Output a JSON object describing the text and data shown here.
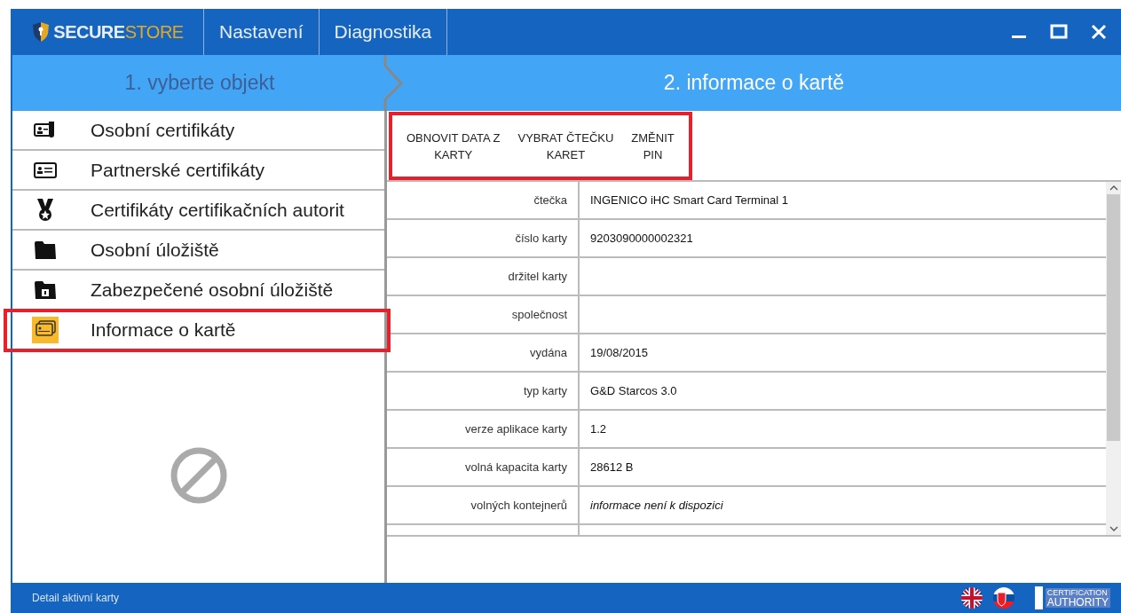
{
  "logo": {
    "primary": "SECURE",
    "secondary": "STORE"
  },
  "menu": [
    {
      "label": "Nastavení"
    },
    {
      "label": "Diagnostika"
    }
  ],
  "steps": [
    {
      "label": "1. vyberte objekt",
      "active": false
    },
    {
      "label": "2. informace o kartě",
      "active": true
    }
  ],
  "sidebar": {
    "items": [
      {
        "label": "Osobní certifikáty",
        "kind": "cert",
        "selected": false,
        "highlighted": false
      },
      {
        "label": "Partnerské certifikáty",
        "kind": "card",
        "selected": false,
        "highlighted": false
      },
      {
        "label": "Certifikáty certifikačních autorit",
        "kind": "medal",
        "selected": false,
        "highlighted": false
      },
      {
        "label": "Osobní úložiště",
        "kind": "folder",
        "selected": false,
        "highlighted": false
      },
      {
        "label": "Zabezpečené osobní úložiště",
        "kind": "lockfolder",
        "selected": false,
        "highlighted": false
      },
      {
        "label": "Informace o kartě",
        "kind": "cards",
        "selected": true,
        "highlighted": true
      }
    ]
  },
  "toolbar": {
    "highlighted": true,
    "buttons": [
      {
        "lines": [
          "OBNOVIT DATA Z",
          "KARTY"
        ]
      },
      {
        "lines": [
          "VYBRAT ČTEČKU",
          "KARET"
        ]
      },
      {
        "lines": [
          "ZMĚNIT",
          "PIN"
        ]
      }
    ]
  },
  "table": {
    "rows": [
      {
        "label": "čtečka",
        "value": "INGENICO iHC Smart Card Terminal 1",
        "italic": false
      },
      {
        "label": "číslo karty",
        "value": "9203090000002321",
        "italic": false
      },
      {
        "label": "držitel karty"
      },
      {
        "label": "společnost"
      },
      {
        "label": "vydána",
        "value": "19/08/2015",
        "italic": false
      },
      {
        "label": "typ karty",
        "value": "G&D Starcos 3.0",
        "italic": false
      },
      {
        "label": "verze aplikace karty",
        "value": "1.2",
        "italic": false
      },
      {
        "label": "volná kapacita karty",
        "value": "28612 B",
        "italic": false
      },
      {
        "label": "volných kontejnerů",
        "value": "informace není k dispozici",
        "italic": true
      }
    ]
  },
  "status_bar": {
    "text": "Detail aktivní karty",
    "ca_logo": [
      "CERTIFICATION",
      "AUTHORITY"
    ]
  }
}
